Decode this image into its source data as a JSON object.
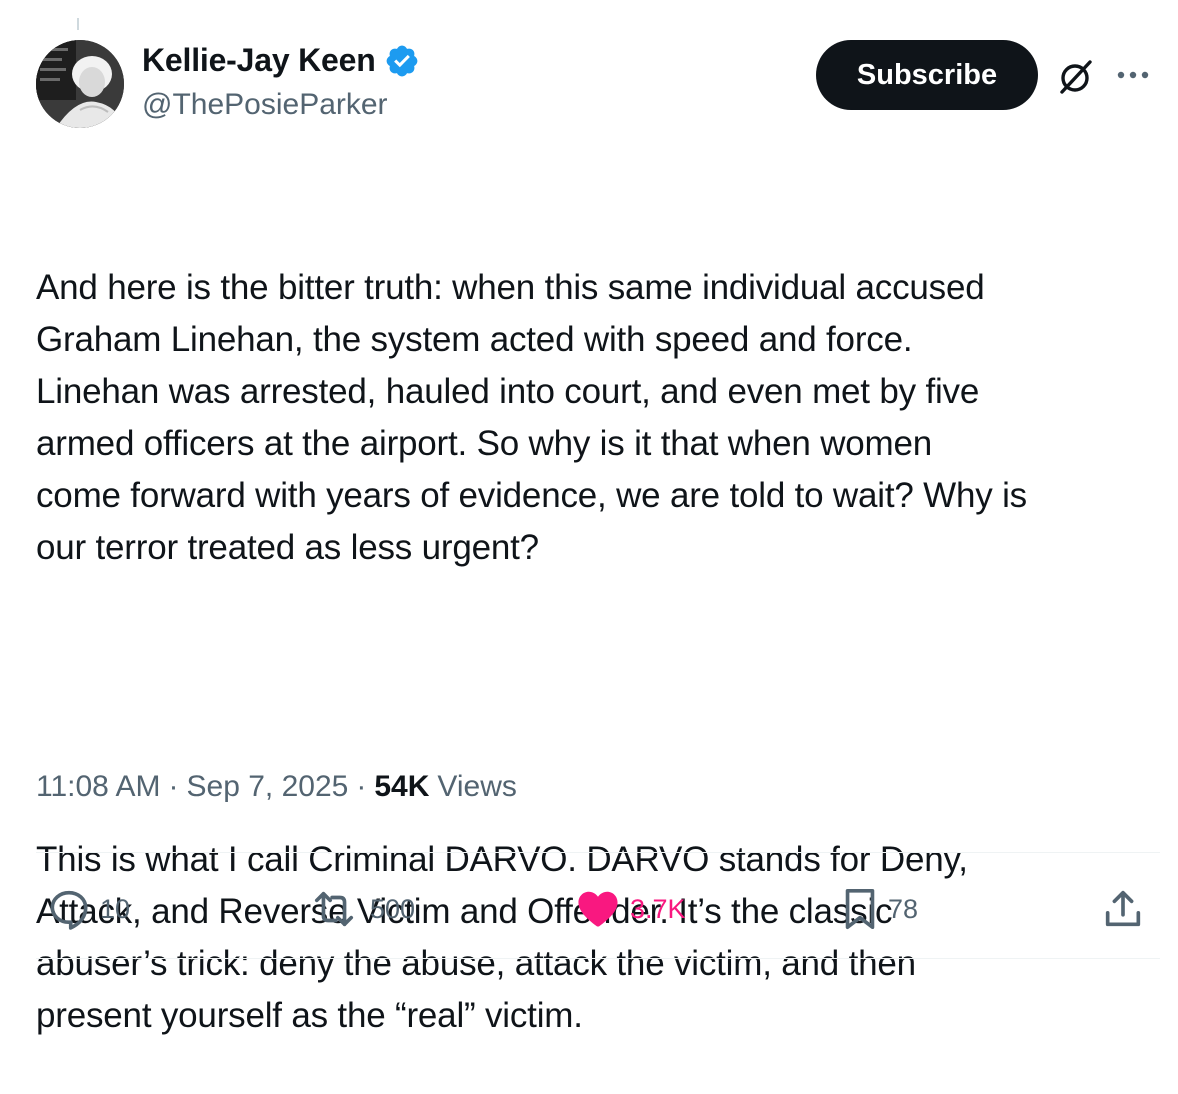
{
  "author": {
    "display_name": "Kellie-Jay Keen",
    "handle": "@ThePosieParker",
    "verified": true
  },
  "header": {
    "subscribe_label": "Subscribe"
  },
  "tweet": {
    "paragraphs": [
      "And here is the bitter truth: when this same individual accused\nGraham Linehan, the system acted with speed and force.\nLinehan was arrested, hauled into court, and even met by five\narmed officers at the airport. So why is it that when women\ncome forward with years of evidence, we are told to wait? Why is\nour terror treated as less urgent?",
      "This is what I call Criminal DARVO. DARVO stands for Deny,\nAttack, and Reverse Victim and Offender. It’s the classic\nabuser’s trick: deny the abuse, attack the victim, and then\npresent yourself as the “real” victim."
    ]
  },
  "meta": {
    "time": "11:08 AM",
    "separator": "·",
    "date": "Sep 7, 2025",
    "views_count": "54K",
    "views_label": "Views"
  },
  "actions": {
    "replies": "10",
    "reposts": "500",
    "likes": "3.7K",
    "bookmarks": "78"
  },
  "icons": {
    "verified": "verified-badge-icon",
    "grok": "grok-icon",
    "more": "more-icon",
    "reply": "reply-icon",
    "repost": "repost-icon",
    "like": "heart-icon",
    "bookmark": "bookmark-icon",
    "share": "share-icon"
  },
  "colors": {
    "text_primary": "#0f1419",
    "text_secondary": "#536471",
    "verified_blue": "#1d9bf0",
    "like_pink": "#f91880",
    "divider": "#eff3f4"
  }
}
